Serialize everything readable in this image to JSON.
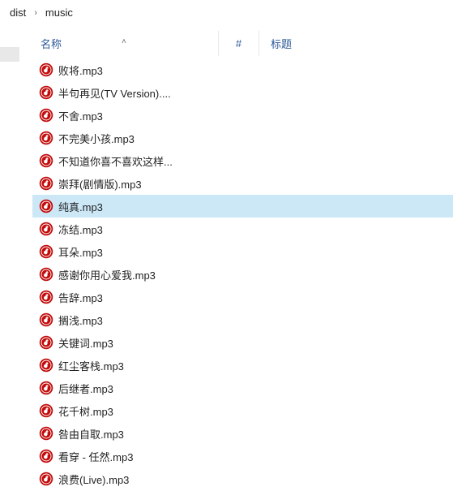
{
  "breadcrumb": {
    "items": [
      "dist",
      "music"
    ],
    "separator": "›"
  },
  "columns": {
    "name": "名称",
    "number": "#",
    "title": "标题",
    "sort_indicator": "˄"
  },
  "icon_color": "#c20c0c",
  "selected_index": 6,
  "files": [
    {
      "name": "败将.mp3"
    },
    {
      "name": "半句再见(TV Version)...."
    },
    {
      "name": "不舍.mp3"
    },
    {
      "name": "不完美小孩.mp3"
    },
    {
      "name": "不知道你喜不喜欢这样..."
    },
    {
      "name": "崇拜(剧情版).mp3"
    },
    {
      "name": "纯真.mp3"
    },
    {
      "name": "冻结.mp3"
    },
    {
      "name": "耳朵.mp3"
    },
    {
      "name": "感谢你用心爱我.mp3"
    },
    {
      "name": "告辞.mp3"
    },
    {
      "name": "搁浅.mp3"
    },
    {
      "name": "关键词.mp3"
    },
    {
      "name": "红尘客栈.mp3"
    },
    {
      "name": "后继者.mp3"
    },
    {
      "name": "花千树.mp3"
    },
    {
      "name": "咎由自取.mp3"
    },
    {
      "name": "看穿 - 任然.mp3"
    },
    {
      "name": "浪费(Live).mp3"
    }
  ]
}
